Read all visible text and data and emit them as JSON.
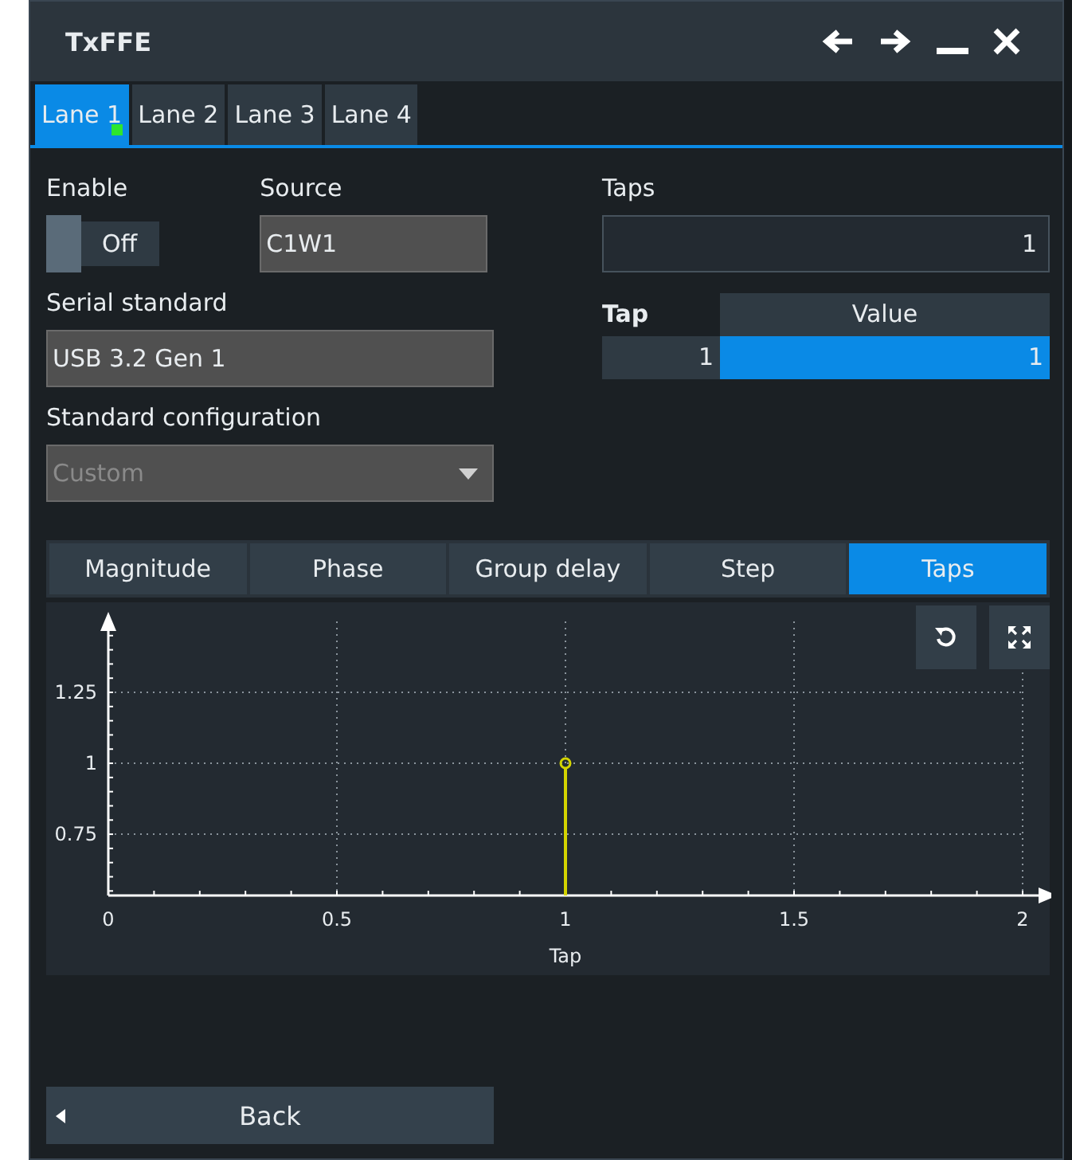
{
  "window": {
    "title": "TxFFE"
  },
  "lanes": [
    {
      "label": "Lane 1",
      "selected": true,
      "indicator": true
    },
    {
      "label": "Lane 2",
      "selected": false,
      "indicator": false
    },
    {
      "label": "Lane 3",
      "selected": false,
      "indicator": false
    },
    {
      "label": "Lane 4",
      "selected": false,
      "indicator": false
    }
  ],
  "enable": {
    "label": "Enable",
    "on": false,
    "text": "Off"
  },
  "source": {
    "label": "Source",
    "value": "C1W1"
  },
  "serial_standard": {
    "label": "Serial standard",
    "value": "USB 3.2 Gen 1"
  },
  "standard_configuration": {
    "label": "Standard configuration",
    "value": "Custom",
    "disabled": true
  },
  "taps": {
    "label": "Taps",
    "value": "1"
  },
  "tap_table": {
    "columns": [
      "Tap",
      "Value"
    ],
    "rows": [
      {
        "cells": [
          "1",
          "1"
        ],
        "selected": true
      }
    ]
  },
  "view_tabs": [
    {
      "label": "Magnitude",
      "selected": false
    },
    {
      "label": "Phase",
      "selected": false
    },
    {
      "label": "Group delay",
      "selected": false
    },
    {
      "label": "Step",
      "selected": false
    },
    {
      "label": "Taps",
      "selected": true
    }
  ],
  "plot": {
    "chart_data": {
      "type": "scatter",
      "xlabel": "Tap",
      "x": [
        1
      ],
      "series": [
        {
          "color": "#d4d400",
          "values": [
            1
          ]
        }
      ],
      "xlim": [
        0,
        2
      ],
      "ylim": [
        0.534,
        1.5
      ],
      "grid": true,
      "xticks": [
        0,
        0.5,
        1,
        1.5,
        2
      ],
      "yticks": [
        0.75,
        1,
        1.25
      ]
    }
  },
  "back_button": {
    "label": "Back"
  }
}
